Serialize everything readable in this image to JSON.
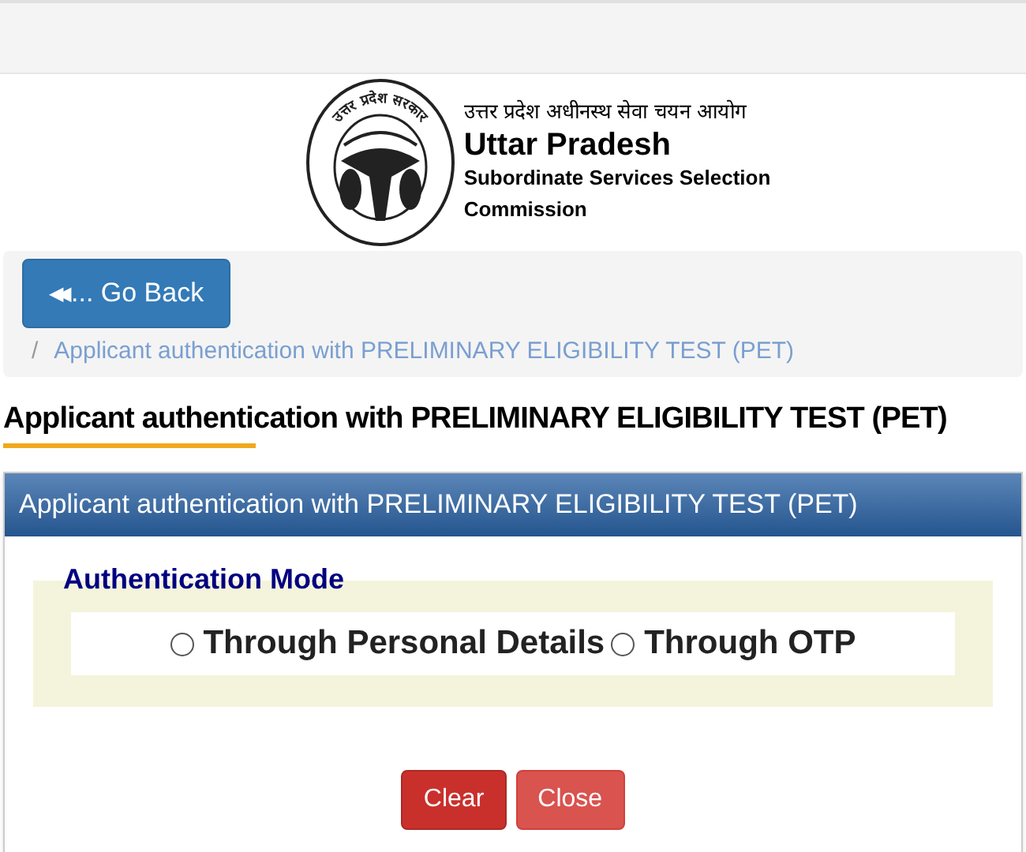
{
  "header": {
    "emblem_text": "उत्तर प्रदेश सरकार",
    "hindi_name": "उत्तर प्रदेश अधीनस्थ सेवा चयन आयोग",
    "title": "Uttar Pradesh",
    "subtitle_lines": [
      "Subordinate Services Selection",
      "Commission"
    ]
  },
  "back_button": {
    "icon": "◀◀",
    "label": "... Go Back"
  },
  "breadcrumb": {
    "separator": "/",
    "current": "Applicant authentication with PRELIMINARY ELIGIBILITY TEST (PET)"
  },
  "page_heading": "Applicant authentication with PRELIMINARY ELIGIBILITY TEST (PET)",
  "panel": {
    "title": "Applicant authentication with PRELIMINARY ELIGIBILITY TEST (PET)",
    "fieldset": {
      "legend": "Authentication Mode",
      "options": [
        {
          "label": "Through Personal Details",
          "selected": false
        },
        {
          "label": "Through OTP",
          "selected": false
        }
      ]
    },
    "buttons": [
      {
        "label": "Clear",
        "kind": "danger"
      },
      {
        "label": "Close",
        "kind": "light-danger"
      }
    ]
  }
}
